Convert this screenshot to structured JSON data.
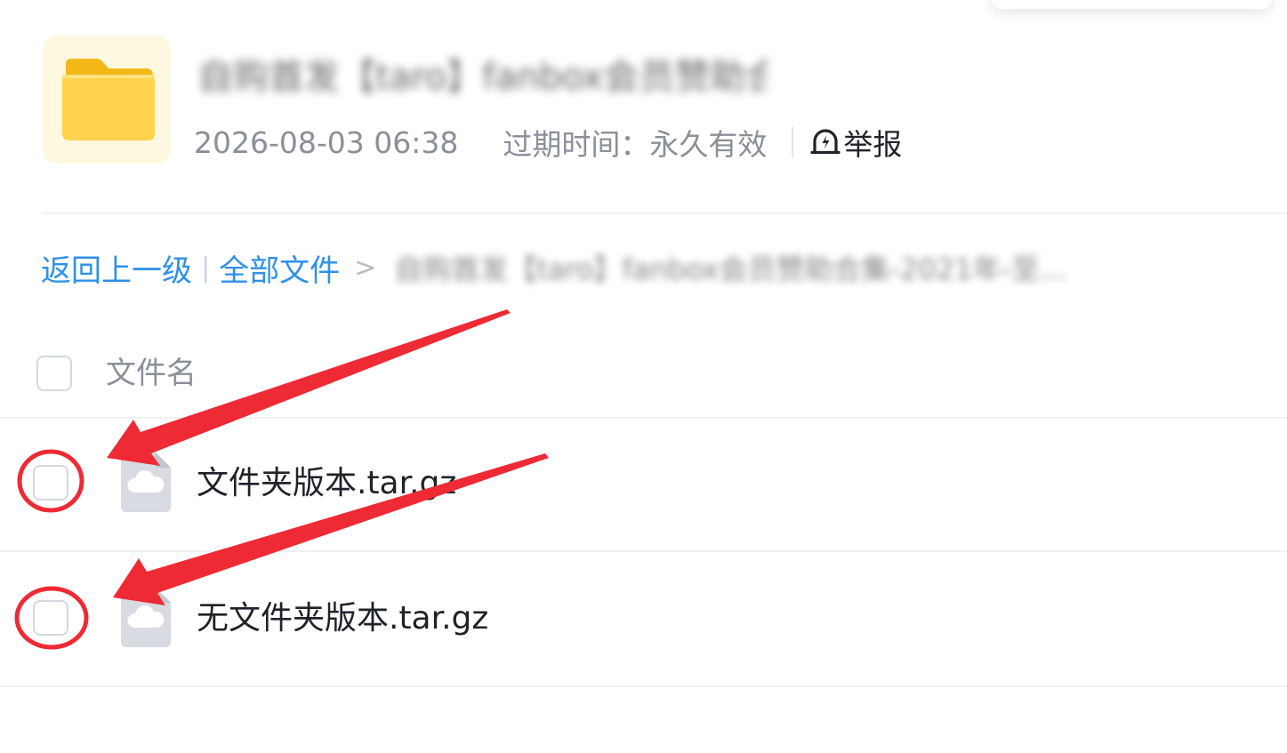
{
  "share": {
    "title": "自购首发【taro】fanbox会员赞助合集...",
    "date": "2026-08-03 06:38",
    "expiry_label": "过期时间：",
    "expiry_value": "永久有效",
    "report_label": "举报"
  },
  "breadcrumb": {
    "back": "返回上一级",
    "separator": "|",
    "all_files": "全部文件",
    "arrow": ">",
    "current": "自购首发【taro】fanbox会员赞助合集-2021年-至..."
  },
  "list": {
    "column_name": "文件名",
    "rows": [
      {
        "name": "文件夹版本.tar.gz",
        "checked": false
      },
      {
        "name": "无文件夹版本.tar.gz",
        "checked": false
      }
    ]
  },
  "colors": {
    "link": "#2f90e8",
    "annotation": "#ee2a34",
    "folder": "#ffd34e",
    "muted_text": "#8a8f99"
  },
  "icons": {
    "folder": "folder-icon",
    "report": "report-icon",
    "file": "cloud-file-icon"
  }
}
